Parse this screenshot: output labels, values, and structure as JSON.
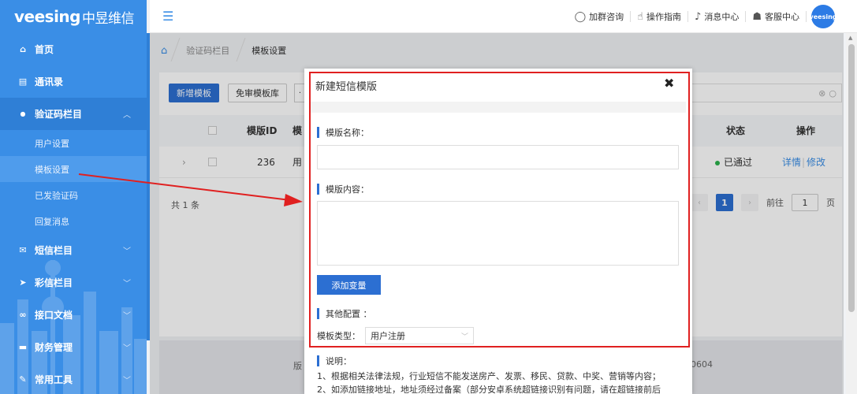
{
  "brand": {
    "logo_text": "veesing",
    "logo_cn": "中昱维信",
    "accent": "#3a8ee6",
    "highlight": "#e02020"
  },
  "sidebar": {
    "items": [
      {
        "icon": "home-icon",
        "glyph": "⌂",
        "label": "首页"
      },
      {
        "icon": "address-book-icon",
        "glyph": "▤",
        "label": "通讯录"
      },
      {
        "icon": "chat-bubble-icon",
        "glyph": "●",
        "label": "验证码栏目",
        "expanded": true
      },
      {
        "icon": "mail-icon",
        "glyph": "✉",
        "label": "短信栏目"
      },
      {
        "icon": "send-icon",
        "glyph": "➤",
        "label": "彩信栏目"
      },
      {
        "icon": "link-icon",
        "glyph": "∞",
        "label": "接口文档"
      },
      {
        "icon": "card-icon",
        "glyph": "▬",
        "label": "财务管理"
      },
      {
        "icon": "wrench-icon",
        "glyph": "✎",
        "label": "常用工具"
      }
    ],
    "sub_items": [
      "用户设置",
      "模板设置",
      "已发验证码",
      "回复消息"
    ]
  },
  "header": {
    "items": [
      {
        "icon": "headset-icon",
        "glyph": "◯",
        "label": "加群咨询"
      },
      {
        "icon": "hand-pointer-icon",
        "glyph": "☝",
        "label": "操作指南"
      },
      {
        "icon": "bell-icon",
        "glyph": "♫",
        "label": "消息中心"
      },
      {
        "icon": "support-agent-icon",
        "glyph": "☗",
        "label": "客服中心"
      }
    ],
    "avatar_text": "veesing"
  },
  "breadcrumb": {
    "items": [
      "验证码栏目",
      "模板设置"
    ]
  },
  "toolbar": {
    "add_label": "新增模板",
    "free_label": "免审模板库"
  },
  "table": {
    "headers": {
      "id": "模版ID",
      "name": "模",
      "status": "状态",
      "action": "操作"
    },
    "row": {
      "id": "236",
      "name": "用",
      "status": "已通过",
      "detail": "详情",
      "edit": "修改"
    }
  },
  "pagination": {
    "total": "共 1 条",
    "current": "1",
    "goto_prefix": "前往",
    "goto_value": "1",
    "goto_suffix": "页"
  },
  "footer": {
    "left": "版",
    "right": "0604"
  },
  "modal": {
    "title": "新建短信模版",
    "close": "✖",
    "name_label": "模版名称：",
    "content_label": "模版内容：",
    "add_var": "添加变量",
    "other_label": "其他配置 ：",
    "type_label": "模板类型：",
    "type_value": "用户注册",
    "note_label": "说明：",
    "note_line1": "1、根据相关法律法规，行业短信不能发送房产、发票、移民、贷款、中奖、营销等内容；",
    "note_line2": "2、如添加链接地址，地址须经过备案（部分安卓系统超链接识别有问题，请在超链接前后"
  }
}
